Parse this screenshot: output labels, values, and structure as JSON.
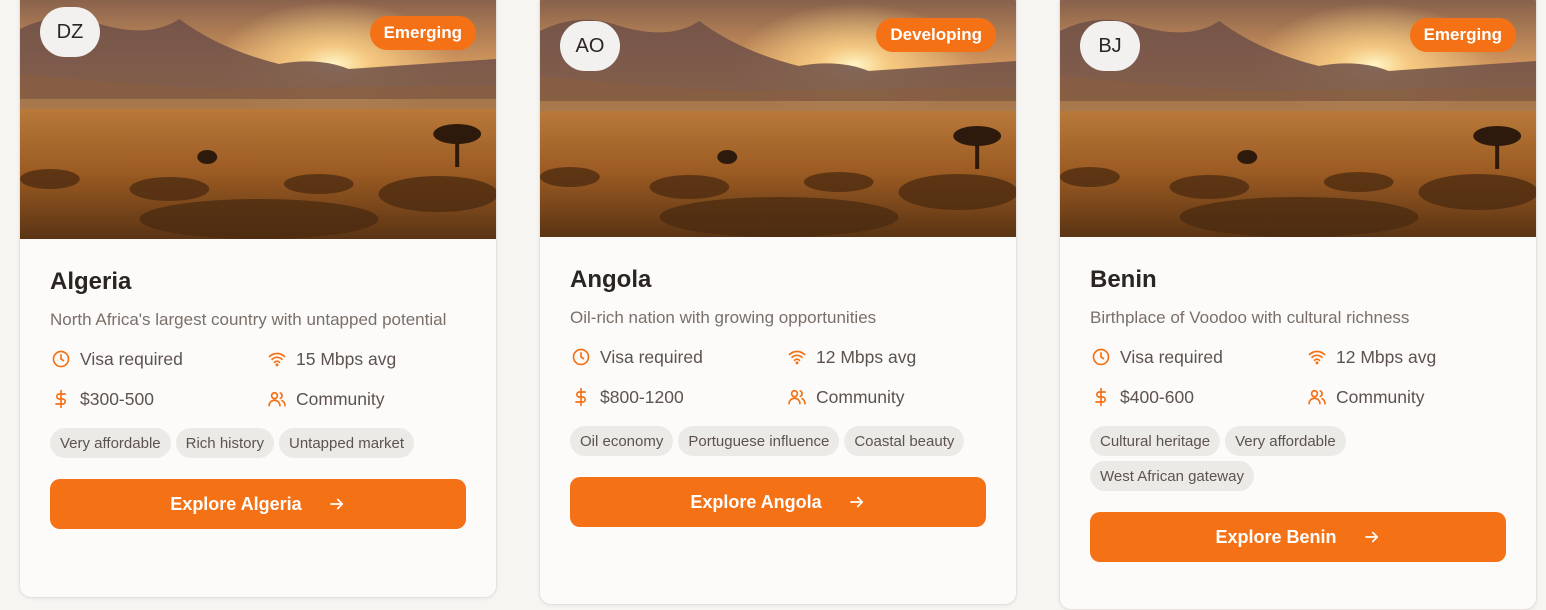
{
  "colors": {
    "accent": "#f47116",
    "tag_bg": "#eceae7",
    "card_bg": "#fcfbf9"
  },
  "cards": [
    {
      "code": "DZ",
      "badge": "Emerging",
      "name": "Algeria",
      "description": "North Africa's largest country with untapped potential",
      "visa": "Visa required",
      "internet": "15 Mbps avg",
      "cost": "$300-500",
      "community": "Community",
      "tags": [
        "Very affordable",
        "Rich history",
        "Untapped market"
      ],
      "cta": "Explore Algeria"
    },
    {
      "code": "AO",
      "badge": "Developing",
      "name": "Angola",
      "description": "Oil-rich nation with growing opportunities",
      "visa": "Visa required",
      "internet": "12 Mbps avg",
      "cost": "$800-1200",
      "community": "Community",
      "tags": [
        "Oil economy",
        "Portuguese influence",
        "Coastal beauty"
      ],
      "cta": "Explore Angola"
    },
    {
      "code": "BJ",
      "badge": "Emerging",
      "name": "Benin",
      "description": "Birthplace of Voodoo with cultural richness",
      "visa": "Visa required",
      "internet": "12 Mbps avg",
      "cost": "$400-600",
      "community": "Community",
      "tags": [
        "Cultural heritage",
        "Very affordable",
        "West African gateway"
      ],
      "cta": "Explore Benin"
    }
  ],
  "icons": {
    "visa": "clock-icon",
    "internet": "wifi-icon",
    "cost": "dollar-icon",
    "community": "users-icon",
    "cta": "arrow-right-icon"
  }
}
